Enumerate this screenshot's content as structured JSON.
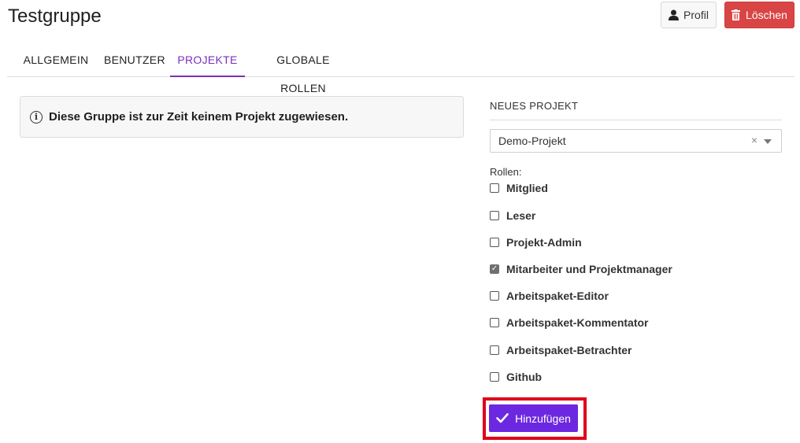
{
  "header": {
    "title": "Testgruppe",
    "profile_label": "Profil",
    "delete_label": "Löschen"
  },
  "tabs": [
    {
      "label": "ALLGEMEIN",
      "active": false
    },
    {
      "label": "BENUTZER",
      "active": false
    },
    {
      "label": "PROJEKTE",
      "active": true
    },
    {
      "label": "GLOBALE ROLLEN",
      "active": false
    }
  ],
  "notice": {
    "text": "Diese Gruppe ist zur Zeit keinem Projekt zugewiesen."
  },
  "new_project": {
    "section_title": "NEUES PROJEKT",
    "selected_project": "Demo-Projekt",
    "clear_symbol": "×",
    "roles_label": "Rollen:",
    "roles": [
      {
        "label": "Mitglied",
        "checked": false
      },
      {
        "label": "Leser",
        "checked": false
      },
      {
        "label": "Projekt-Admin",
        "checked": false
      },
      {
        "label": "Mitarbeiter und Projektmanager",
        "checked": true
      },
      {
        "label": "Arbeitspaket-Editor",
        "checked": false
      },
      {
        "label": "Arbeitspaket-Kommentator",
        "checked": false
      },
      {
        "label": "Arbeitspaket-Betrachter",
        "checked": false
      },
      {
        "label": "Github",
        "checked": false
      }
    ],
    "add_label": "Hinzufügen"
  },
  "colors": {
    "accent": "#7a2fbd",
    "danger": "#d94545",
    "primary_button": "#6c28e0",
    "highlight": "#e0001a"
  }
}
